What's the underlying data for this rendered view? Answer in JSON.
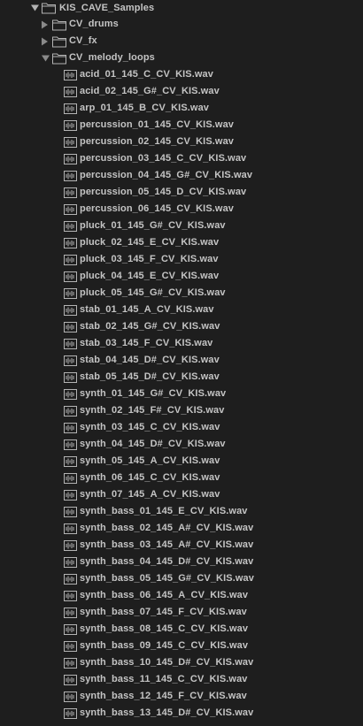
{
  "tree": {
    "root": {
      "label": "KIS_CAVE_Samples",
      "expanded": true
    },
    "folders": [
      {
        "label": "CV_drums",
        "expanded": false
      },
      {
        "label": "CV_fx",
        "expanded": false
      },
      {
        "label": "CV_melody_loops",
        "expanded": true
      }
    ],
    "files": [
      "acid_01_145_C_CV_KIS.wav",
      "acid_02_145_G#_CV_KIS.wav",
      "arp_01_145_B_CV_KIS.wav",
      "percussion_01_145_CV_KIS.wav",
      "percussion_02_145_CV_KIS.wav",
      "percussion_03_145_C_CV_KIS.wav",
      "percussion_04_145_G#_CV_KIS.wav",
      "percussion_05_145_D_CV_KIS.wav",
      "percussion_06_145_CV_KIS.wav",
      "pluck_01_145_G#_CV_KIS.wav",
      "pluck_02_145_E_CV_KIS.wav",
      "pluck_03_145_F_CV_KIS.wav",
      "pluck_04_145_E_CV_KIS.wav",
      "pluck_05_145_G#_CV_KIS.wav",
      "stab_01_145_A_CV_KIS.wav",
      "stab_02_145_G#_CV_KIS.wav",
      "stab_03_145_F_CV_KIS.wav",
      "stab_04_145_D#_CV_KIS.wav",
      "stab_05_145_D#_CV_KIS.wav",
      "synth_01_145_G#_CV_KIS.wav",
      "synth_02_145_F#_CV_KIS.wav",
      "synth_03_145_C_CV_KIS.wav",
      "synth_04_145_D#_CV_KIS.wav",
      "synth_05_145_A_CV_KIS.wav",
      "synth_06_145_C_CV_KIS.wav",
      "synth_07_145_A_CV_KIS.wav",
      "synth_bass_01_145_E_CV_KIS.wav",
      "synth_bass_02_145_A#_CV_KIS.wav",
      "synth_bass_03_145_A#_CV_KIS.wav",
      "synth_bass_04_145_D#_CV_KIS.wav",
      "synth_bass_05_145_G#_CV_KIS.wav",
      "synth_bass_06_145_A_CV_KIS.wav",
      "synth_bass_07_145_F_CV_KIS.wav",
      "synth_bass_08_145_C_CV_KIS.wav",
      "synth_bass_09_145_C_CV_KIS.wav",
      "synth_bass_10_145_D#_CV_KIS.wav",
      "synth_bass_11_145_C_CV_KIS.wav",
      "synth_bass_12_145_F_CV_KIS.wav",
      "synth_bass_13_145_D#_CV_KIS.wav"
    ]
  },
  "icons": {
    "expanded_arrow": "triangle-down-icon",
    "collapsed_arrow": "triangle-right-icon",
    "folder": "folder-icon",
    "audio_file": "waveform-file-icon"
  },
  "colors": {
    "background": "#1e1e1e",
    "text": "#c4c4c4",
    "icon": "#b4b4b4"
  }
}
